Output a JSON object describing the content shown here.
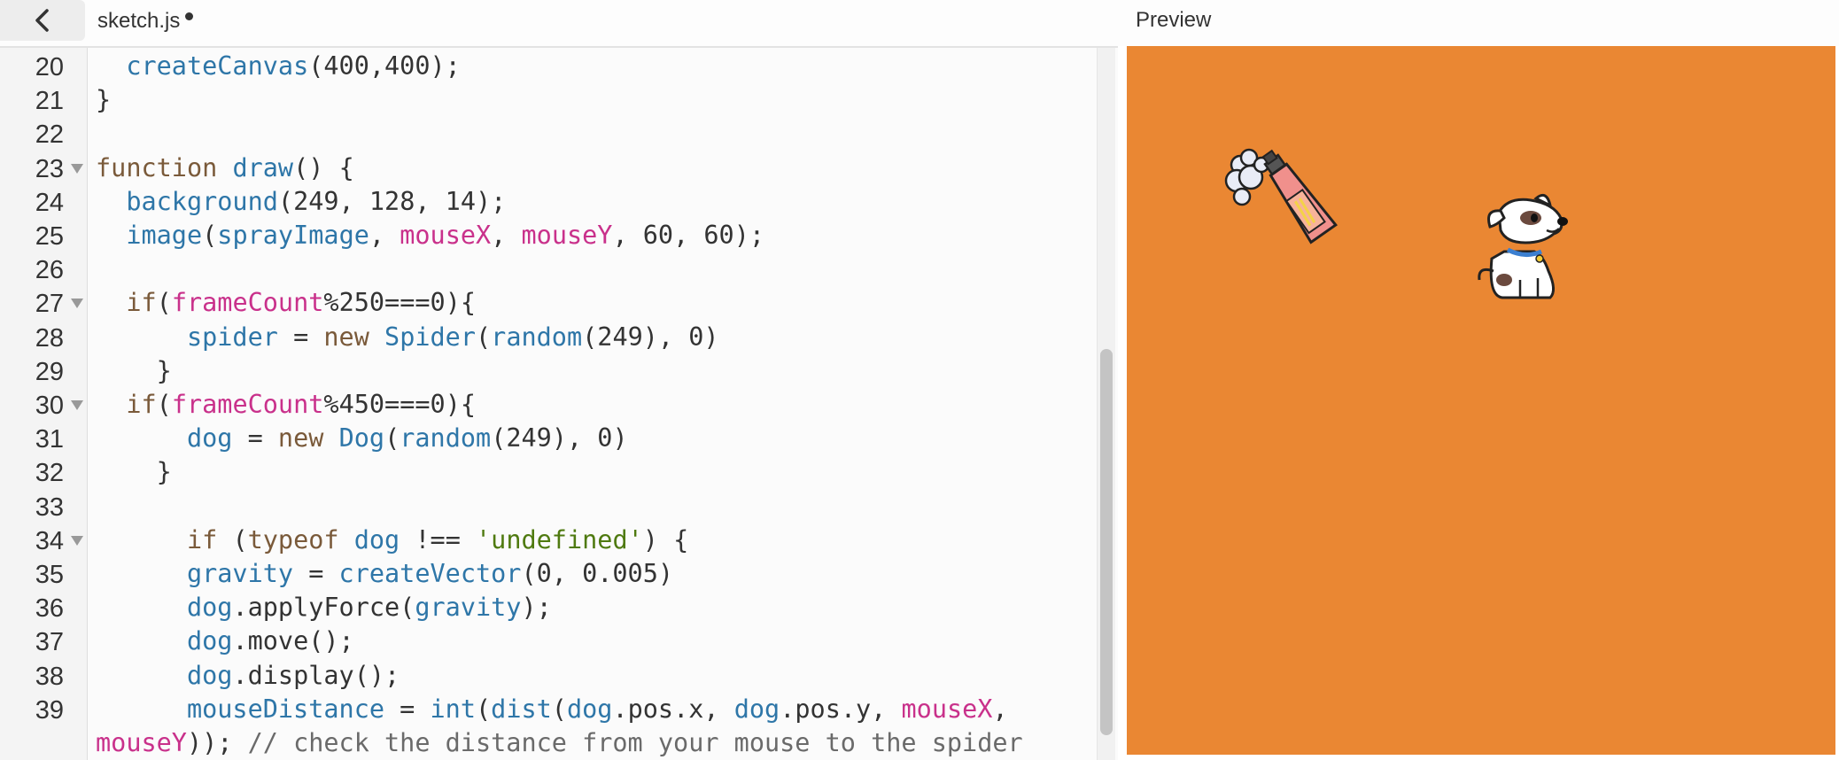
{
  "topbar": {
    "back_label": "back",
    "file_name": "sketch.js",
    "unsaved": true,
    "preview_label": "Preview"
  },
  "editor": {
    "lines": [
      {
        "num": "20",
        "fold": false
      },
      {
        "num": "21",
        "fold": false
      },
      {
        "num": "22",
        "fold": false
      },
      {
        "num": "23",
        "fold": true
      },
      {
        "num": "24",
        "fold": false
      },
      {
        "num": "25",
        "fold": false
      },
      {
        "num": "26",
        "fold": false
      },
      {
        "num": "27",
        "fold": true
      },
      {
        "num": "28",
        "fold": false
      },
      {
        "num": "29",
        "fold": false
      },
      {
        "num": "30",
        "fold": true
      },
      {
        "num": "31",
        "fold": false
      },
      {
        "num": "32",
        "fold": false
      },
      {
        "num": "33",
        "fold": false
      },
      {
        "num": "34",
        "fold": true
      },
      {
        "num": "35",
        "fold": false
      },
      {
        "num": "36",
        "fold": false
      },
      {
        "num": "37",
        "fold": false
      },
      {
        "num": "38",
        "fold": false
      },
      {
        "num": "39",
        "fold": false
      },
      {
        "num": "",
        "fold": false
      }
    ],
    "code": [
      [
        {
          "t": "  "
        },
        {
          "t": "createCanvas",
          "c": "fn"
        },
        {
          "t": "(400,400);"
        }
      ],
      [
        {
          "t": "}"
        }
      ],
      [
        {
          "t": ""
        }
      ],
      [
        {
          "t": "function",
          "c": "kw"
        },
        {
          "t": " "
        },
        {
          "t": "draw",
          "c": "fn"
        },
        {
          "t": "() {"
        }
      ],
      [
        {
          "t": "  "
        },
        {
          "t": "background",
          "c": "fn"
        },
        {
          "t": "(249, 128, 14);"
        }
      ],
      [
        {
          "t": "  "
        },
        {
          "t": "image",
          "c": "fn"
        },
        {
          "t": "("
        },
        {
          "t": "sprayImage",
          "c": "var"
        },
        {
          "t": ", "
        },
        {
          "t": "mouseX",
          "c": "sys"
        },
        {
          "t": ", "
        },
        {
          "t": "mouseY",
          "c": "sys"
        },
        {
          "t": ", 60, 60);"
        }
      ],
      [
        {
          "t": ""
        }
      ],
      [
        {
          "t": "  "
        },
        {
          "t": "if",
          "c": "kw"
        },
        {
          "t": "("
        },
        {
          "t": "frameCount",
          "c": "sys"
        },
        {
          "t": "%250===0){"
        }
      ],
      [
        {
          "t": "      "
        },
        {
          "t": "spider",
          "c": "var"
        },
        {
          "t": " = "
        },
        {
          "t": "new",
          "c": "kw"
        },
        {
          "t": " "
        },
        {
          "t": "Spider",
          "c": "var"
        },
        {
          "t": "("
        },
        {
          "t": "random",
          "c": "fn"
        },
        {
          "t": "(249), 0)"
        }
      ],
      [
        {
          "t": "    }"
        }
      ],
      [
        {
          "t": "  "
        },
        {
          "t": "if",
          "c": "kw"
        },
        {
          "t": "("
        },
        {
          "t": "frameCount",
          "c": "sys"
        },
        {
          "t": "%450===0){"
        }
      ],
      [
        {
          "t": "      "
        },
        {
          "t": "dog",
          "c": "var"
        },
        {
          "t": " = "
        },
        {
          "t": "new",
          "c": "kw"
        },
        {
          "t": " "
        },
        {
          "t": "Dog",
          "c": "var"
        },
        {
          "t": "("
        },
        {
          "t": "random",
          "c": "fn"
        },
        {
          "t": "(249), 0)"
        }
      ],
      [
        {
          "t": "    }"
        }
      ],
      [
        {
          "t": ""
        }
      ],
      [
        {
          "t": "      "
        },
        {
          "t": "if",
          "c": "kw"
        },
        {
          "t": " ("
        },
        {
          "t": "typeof",
          "c": "kw"
        },
        {
          "t": " "
        },
        {
          "t": "dog",
          "c": "var"
        },
        {
          "t": " !== "
        },
        {
          "t": "'undefined'",
          "c": "str"
        },
        {
          "t": ") {"
        }
      ],
      [
        {
          "t": "      "
        },
        {
          "t": "gravity",
          "c": "var"
        },
        {
          "t": " = "
        },
        {
          "t": "createVector",
          "c": "fn"
        },
        {
          "t": "(0, 0.005)"
        }
      ],
      [
        {
          "t": "      "
        },
        {
          "t": "dog",
          "c": "var"
        },
        {
          "t": ".applyForce("
        },
        {
          "t": "gravity",
          "c": "var"
        },
        {
          "t": ");"
        }
      ],
      [
        {
          "t": "      "
        },
        {
          "t": "dog",
          "c": "var"
        },
        {
          "t": ".move();"
        }
      ],
      [
        {
          "t": "      "
        },
        {
          "t": "dog",
          "c": "var"
        },
        {
          "t": ".display();"
        }
      ],
      [
        {
          "t": "      "
        },
        {
          "t": "mouseDistance",
          "c": "var"
        },
        {
          "t": " = "
        },
        {
          "t": "int",
          "c": "fn"
        },
        {
          "t": "("
        },
        {
          "t": "dist",
          "c": "fn"
        },
        {
          "t": "("
        },
        {
          "t": "dog",
          "c": "var"
        },
        {
          "t": ".pos.x, "
        },
        {
          "t": "dog",
          "c": "var"
        },
        {
          "t": ".pos.y, "
        },
        {
          "t": "mouseX",
          "c": "sys"
        },
        {
          "t": ","
        }
      ],
      [
        {
          "t": "mouseY",
          "c": "sys"
        },
        {
          "t": ")); "
        },
        {
          "t": "// check the distance from your mouse to the spider",
          "c": "cm"
        }
      ]
    ]
  },
  "preview": {
    "canvas_color": "#ea8733",
    "sprites": [
      "spray-bottle-icon",
      "dog-icon"
    ]
  },
  "colors": {
    "keyword": "#7a5a3a",
    "function": "#2e76a8",
    "builtin": "#c9318b",
    "string": "#4f7a10",
    "comment": "#6a6a6a"
  }
}
